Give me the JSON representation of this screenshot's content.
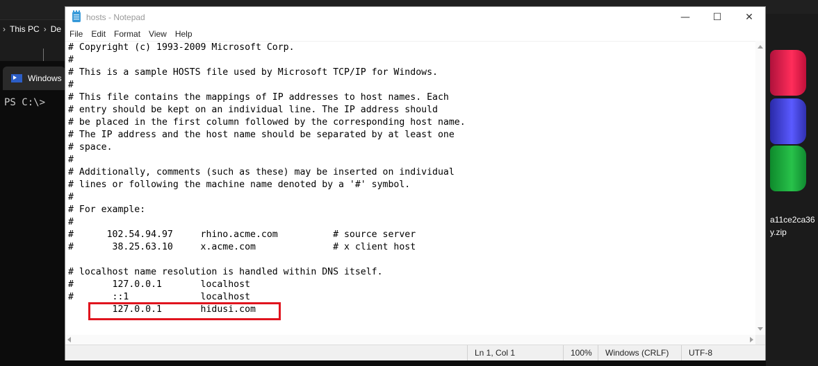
{
  "background": {
    "breadcrumb": [
      "This PC",
      "De"
    ],
    "terminal_tab_label": "Windows",
    "terminal_prompt": "PS C:\\>",
    "zip_name_lines": [
      "a11ce2ca36",
      "y.zip"
    ]
  },
  "window": {
    "title": "hosts - Notepad",
    "buttons": {
      "minimize": "—",
      "maximize": "☐",
      "close": "✕"
    }
  },
  "menu": [
    "File",
    "Edit",
    "Format",
    "View",
    "Help"
  ],
  "editor_lines": [
    "# Copyright (c) 1993-2009 Microsoft Corp.",
    "#",
    "# This is a sample HOSTS file used by Microsoft TCP/IP for Windows.",
    "#",
    "# This file contains the mappings of IP addresses to host names. Each",
    "# entry should be kept on an individual line. The IP address should",
    "# be placed in the first column followed by the corresponding host name.",
    "# The IP address and the host name should be separated by at least one",
    "# space.",
    "#",
    "# Additionally, comments (such as these) may be inserted on individual",
    "# lines or following the machine name denoted by a '#' symbol.",
    "#",
    "# For example:",
    "#",
    "#      102.54.94.97     rhino.acme.com          # source server",
    "#       38.25.63.10     x.acme.com              # x client host",
    "",
    "# localhost name resolution is handled within DNS itself.",
    "#       127.0.0.1       localhost",
    "#       ::1             localhost",
    "        127.0.0.1       hidusi.com"
  ],
  "status": {
    "position": "Ln 1, Col 1",
    "zoom": "100%",
    "line_ending": "Windows (CRLF)",
    "encoding": "UTF-8"
  },
  "colors": {
    "highlight_box": "#e0141e"
  }
}
